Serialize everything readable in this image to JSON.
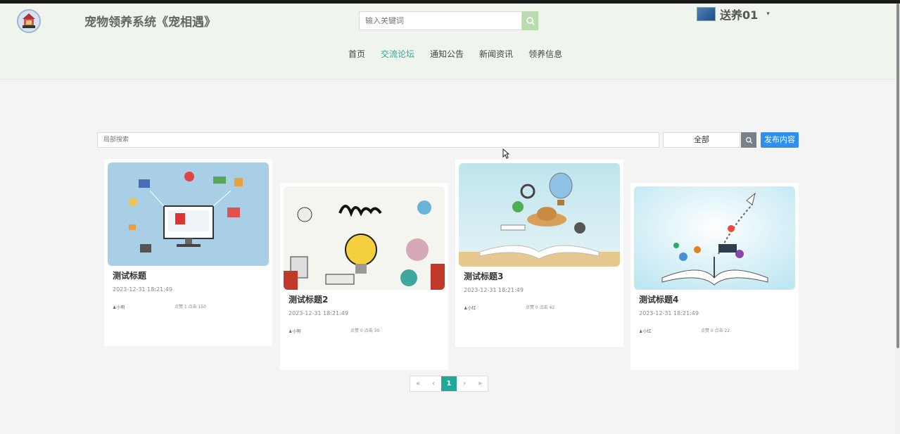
{
  "header": {
    "title": "宠物领养系统《宠相遇》",
    "search_placeholder": "输入关键词",
    "user_name": "送养01",
    "user_caret": "▾"
  },
  "nav": [
    {
      "label": "首页",
      "active": false
    },
    {
      "label": "交流论坛",
      "active": true
    },
    {
      "label": "通知公告",
      "active": false
    },
    {
      "label": "新闻资讯",
      "active": false
    },
    {
      "label": "领养信息",
      "active": false
    }
  ],
  "filter": {
    "search_placeholder": "局部搜索",
    "select_value": "全部",
    "publish_label": "发布内容"
  },
  "posts": [
    {
      "title": "测试标题",
      "date": "2023-12-31 18:21:49",
      "author": "小明",
      "stats": "点赞 1 点击 150"
    },
    {
      "title": "测试标题2",
      "date": "2023-12-31 18:21:49",
      "author": "小明",
      "stats": "点赞 0 点击 30"
    },
    {
      "title": "测试标题3",
      "date": "2023-12-31 18:21:49",
      "author": "小红",
      "stats": "点赞 0 点击 42"
    },
    {
      "title": "测试标题4",
      "date": "2023-12-31 18:21:49",
      "author": "小红",
      "stats": "点赞 0 点击 22"
    }
  ],
  "pagination": {
    "first": "«",
    "prev": "‹",
    "current": "1",
    "next": "›",
    "last": "»"
  },
  "colors": {
    "accent": "#2aa89b",
    "header_bg": "#eff5ec",
    "publish_btn": "#2f8ff0",
    "pager_active": "#20a899"
  },
  "icons": [
    "logo-emblem",
    "search-icon",
    "user-avatar",
    "user-icon",
    "chevron-down-icon"
  ]
}
